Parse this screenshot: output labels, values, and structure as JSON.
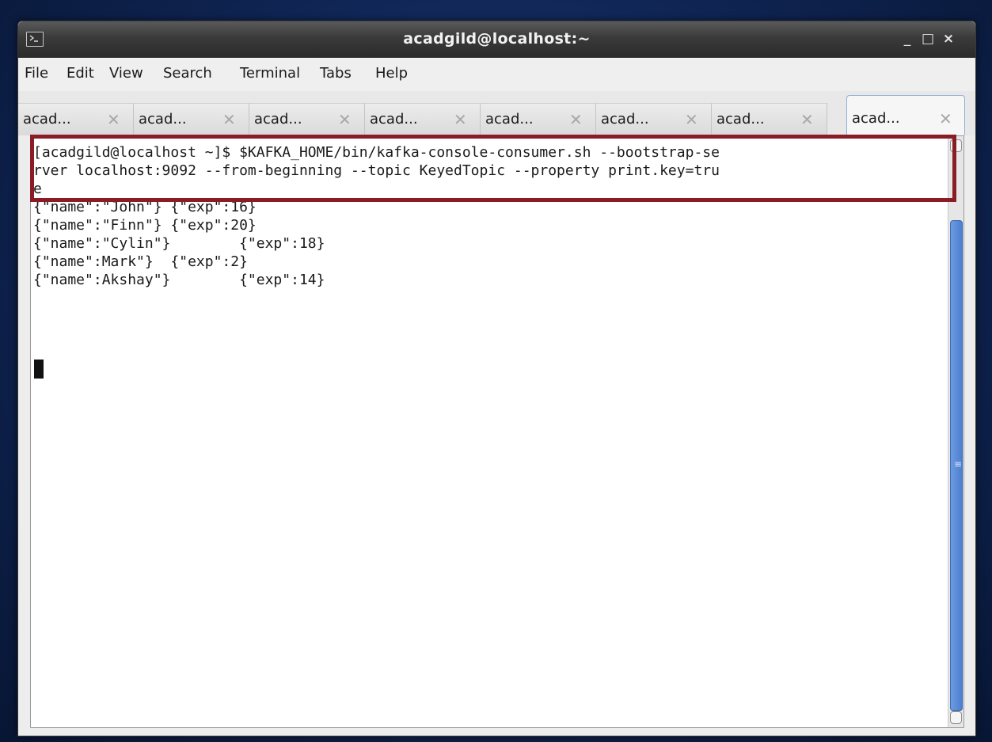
{
  "window": {
    "title": "acadgild@localhost:~",
    "icon": "terminal-icon",
    "controls": {
      "minimize": "_",
      "maximize": "□",
      "close": "×"
    }
  },
  "menubar": {
    "items": [
      "File",
      "Edit",
      "View",
      "Search",
      "Terminal",
      "Tabs",
      "Help"
    ]
  },
  "tabs": {
    "labels": [
      "acad...",
      "acad...",
      "acad...",
      "acad...",
      "acad...",
      "acad...",
      "acad...",
      "acad..."
    ],
    "close_glyph": "✕",
    "active_index": 7
  },
  "terminal": {
    "lines": [
      "[acadgild@localhost ~]$ $KAFKA_HOME/bin/kafka-console-consumer.sh --bootstrap-se",
      "rver localhost:9092 --from-beginning --topic KeyedTopic --property print.key=tru",
      "e",
      "{\"name\":\"John\"} {\"exp\":16}",
      "{\"name\":\"Finn\"} {\"exp\":20}",
      "{\"name\":\"Cylin\"}        {\"exp\":18}",
      "{\"name\":Mark\"}  {\"exp\":2}",
      "{\"name\":Akshay\"}        {\"exp\":14}"
    ],
    "highlight_color": "#8a1c26"
  },
  "scrollbar": {
    "thumb_grip": "≡"
  }
}
